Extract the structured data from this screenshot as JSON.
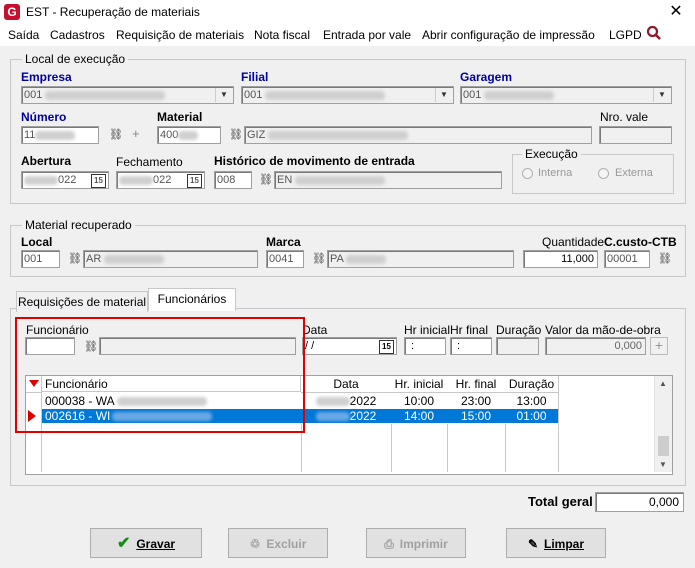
{
  "window": {
    "title": "EST - Recuperação de materiais",
    "close": "✕"
  },
  "menu": [
    "Saída",
    "Cadastros",
    "Requisição de materiais",
    "Nota fiscal",
    "Entrada por vale",
    "Abrir configuração de impressão",
    "LGPD"
  ],
  "local_execucao": {
    "legend": "Local de execução",
    "empresa_label": "Empresa",
    "empresa_value": "001",
    "filial_label": "Filial",
    "filial_value": "001",
    "garagem_label": "Garagem",
    "garagem_value": "001",
    "numero_label": "Número",
    "numero_value": "11",
    "material_label": "Material",
    "material_value": "400",
    "material_desc": "GIZ",
    "nro_vale_label": "Nro. vale",
    "abertura_label": "Abertura",
    "abertura_value": "022",
    "fechamento_label": "Fechamento",
    "fechamento_value": "022",
    "historico_label": "Histórico de movimento de entrada",
    "historico_code": "008",
    "historico_desc": "EN",
    "execucao_legend": "Execução",
    "interna": "Interna",
    "externa": "Externa",
    "cal_icon": "15"
  },
  "material_recuperado": {
    "legend": "Material recuperado",
    "local_label": "Local",
    "local_value": "001",
    "local_desc": "AR",
    "marca_label": "Marca",
    "marca_value": "0041",
    "marca_desc": "PA",
    "quantidade_label": "Quantidade",
    "quantidade_value": "11,000",
    "ccusto_label": "C.custo-CTB",
    "ccusto_value": "00001"
  },
  "tabs": [
    "Requisições de material",
    "Funcionários"
  ],
  "funcionarios_tab": {
    "funcionario_label": "Funcionário",
    "data_label": "Data",
    "data_value": " /  /",
    "hr_inicial_label": "Hr inicial",
    "hr_inicial_value": ":",
    "hr_final_label": "Hr final",
    "hr_final_value": ":",
    "duracao_label": "Duração",
    "valor_label": "Valor da mão-de-obra",
    "valor_value": "0,000"
  },
  "grid": {
    "headers": [
      "Funcionário",
      "Data",
      "Hr. inicial",
      "Hr. final",
      "Duração"
    ],
    "rows": [
      {
        "funcionario": "000038 - WA",
        "data": "2022",
        "hr_inicial": "10:00",
        "hr_final": "23:00",
        "duracao": "13:00",
        "selected": false
      },
      {
        "funcionario": "002616 - WI",
        "data": "2022",
        "hr_inicial": "14:00",
        "hr_final": "15:00",
        "duracao": "01:00",
        "selected": true
      }
    ]
  },
  "total_geral_label": "Total geral",
  "total_geral_value": "0,000",
  "buttons": {
    "gravar": "Gravar",
    "excluir": "Excluir",
    "imprimir": "Imprimir",
    "limpar": "Limpar"
  },
  "colors": {
    "selection": "#0078d7",
    "accent_blue": "#0000a0",
    "highlight_red": "#e00000"
  }
}
